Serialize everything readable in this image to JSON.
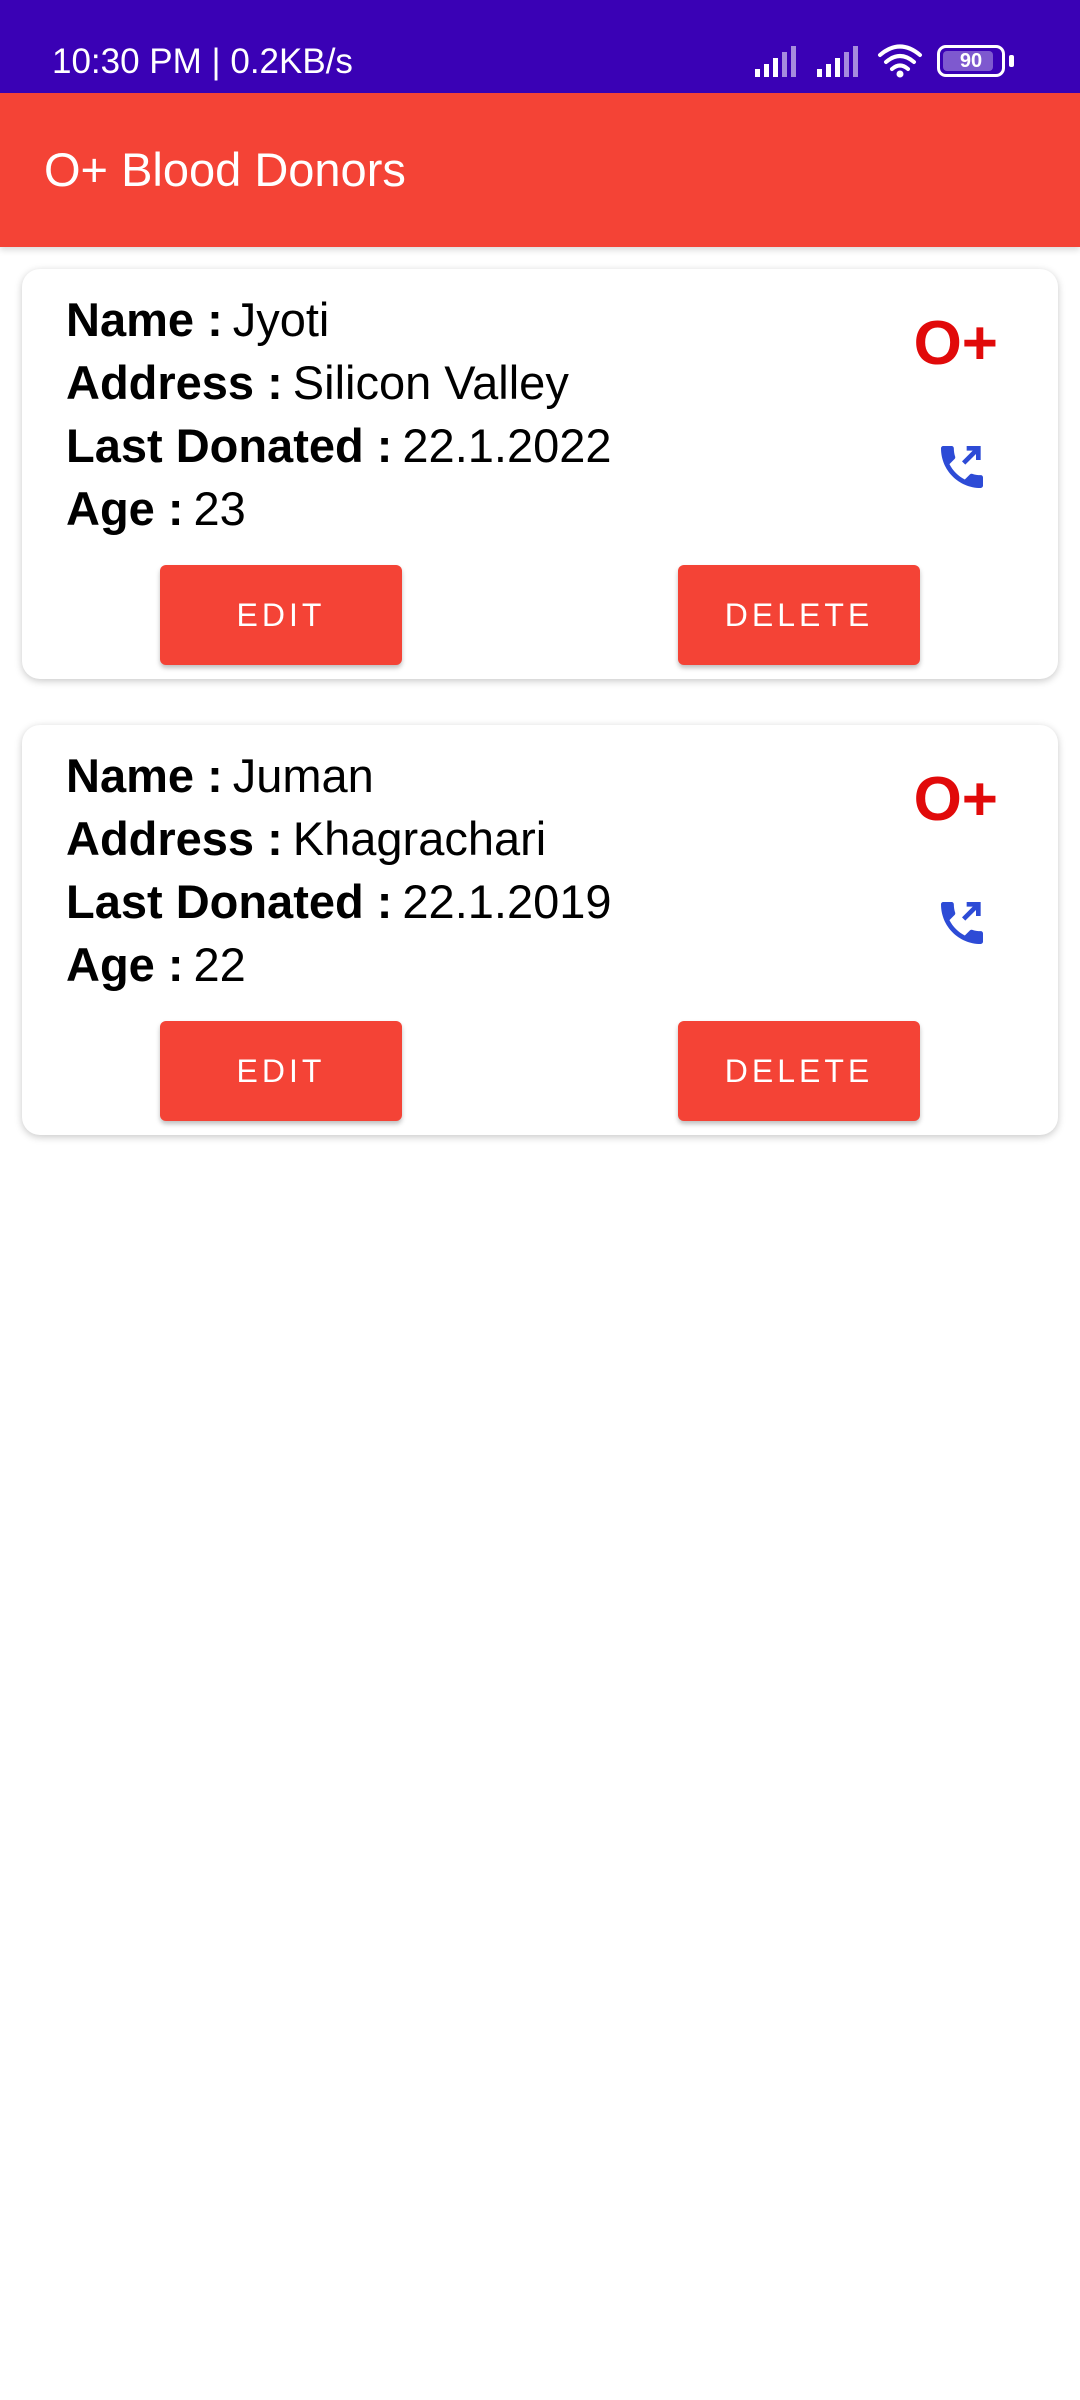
{
  "status_bar": {
    "time": "10:30 PM | 0.2KB/s",
    "battery_level": "90",
    "battery_fraction": 0.9,
    "icons": [
      "signal-icon",
      "signal-icon",
      "wifi-icon",
      "battery-icon"
    ],
    "background_color": "#3a01b5"
  },
  "app_bar": {
    "title": "O+ Blood Donors",
    "color": "#f44336"
  },
  "donors": [
    {
      "name_label": "Name :",
      "name": "Jyoti",
      "address_label": "Address :",
      "address": "Silicon Valley",
      "last_donated_label": "Last Donated :",
      "last_donated": "22.1.2022",
      "age_label": "Age :",
      "age": "23",
      "blood_group": "O+",
      "call_icon": "phone-callback-icon",
      "edit_label": "EDIT",
      "delete_label": "DELETE"
    },
    {
      "name_label": "Name :",
      "name": "Juman",
      "address_label": "Address :",
      "address": "Khagrachari",
      "last_donated_label": "Last Donated :",
      "last_donated": "22.1.2019",
      "age_label": "Age :",
      "age": "22",
      "blood_group": "O+",
      "call_icon": "phone-callback-icon",
      "edit_label": "EDIT",
      "delete_label": "DELETE"
    }
  ],
  "colors": {
    "blood_group_text": "#e10a0a",
    "call_icon": "#2d4bd6",
    "button": "#f44336"
  }
}
